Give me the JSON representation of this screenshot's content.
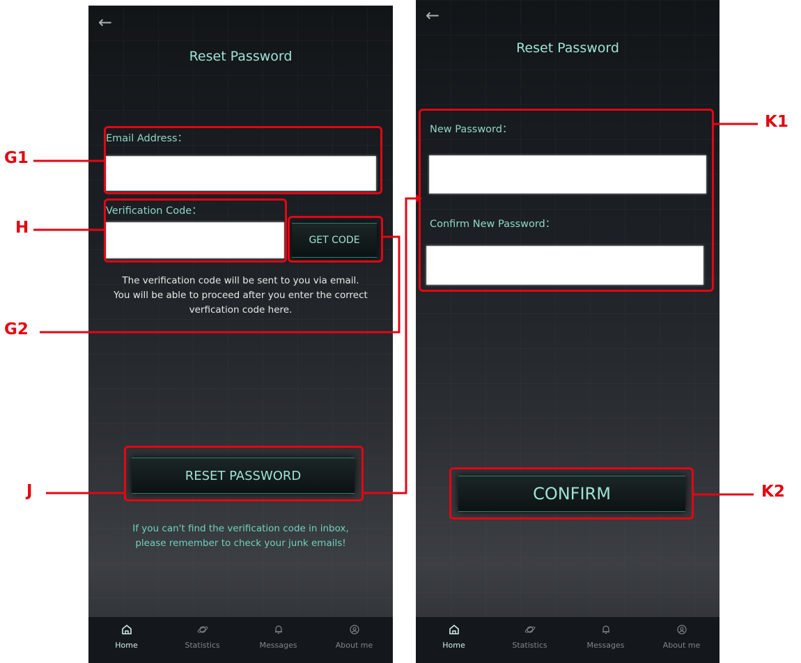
{
  "left_screen": {
    "back_icon": "arrow-left",
    "title": "Reset Password",
    "email_label": "Email Address：",
    "email_value": "",
    "code_label": "Verification Code：",
    "code_value": "",
    "get_code_label": "GET CODE",
    "info_lines": [
      "The verification code will be sent to you via email.",
      "You will be able to proceed after you enter the correct",
      "verfication code here."
    ],
    "reset_button_label": "RESET PASSWORD",
    "hint_lines": [
      "If you can't find the verification code in inbox,",
      "please remember to check your junk emails!"
    ]
  },
  "right_screen": {
    "back_icon": "arrow-left",
    "title": "Reset Password",
    "new_password_label": "New Password：",
    "confirm_password_label": "Confirm New Password：",
    "confirm_button_label": "CONFIRM"
  },
  "tab_bar": {
    "tabs": [
      {
        "label": "Home",
        "icon": "home-icon",
        "active": true
      },
      {
        "label": "Statistics",
        "icon": "planet-icon",
        "active": false
      },
      {
        "label": "Messages",
        "icon": "bell-icon",
        "active": false
      },
      {
        "label": "About me",
        "icon": "user-circle-icon",
        "active": false
      }
    ]
  },
  "annotations": {
    "g1": "G1",
    "h": "H",
    "g2": "G2",
    "j": "J",
    "k1": "K1",
    "k2": "K2",
    "color": "#e30613"
  }
}
